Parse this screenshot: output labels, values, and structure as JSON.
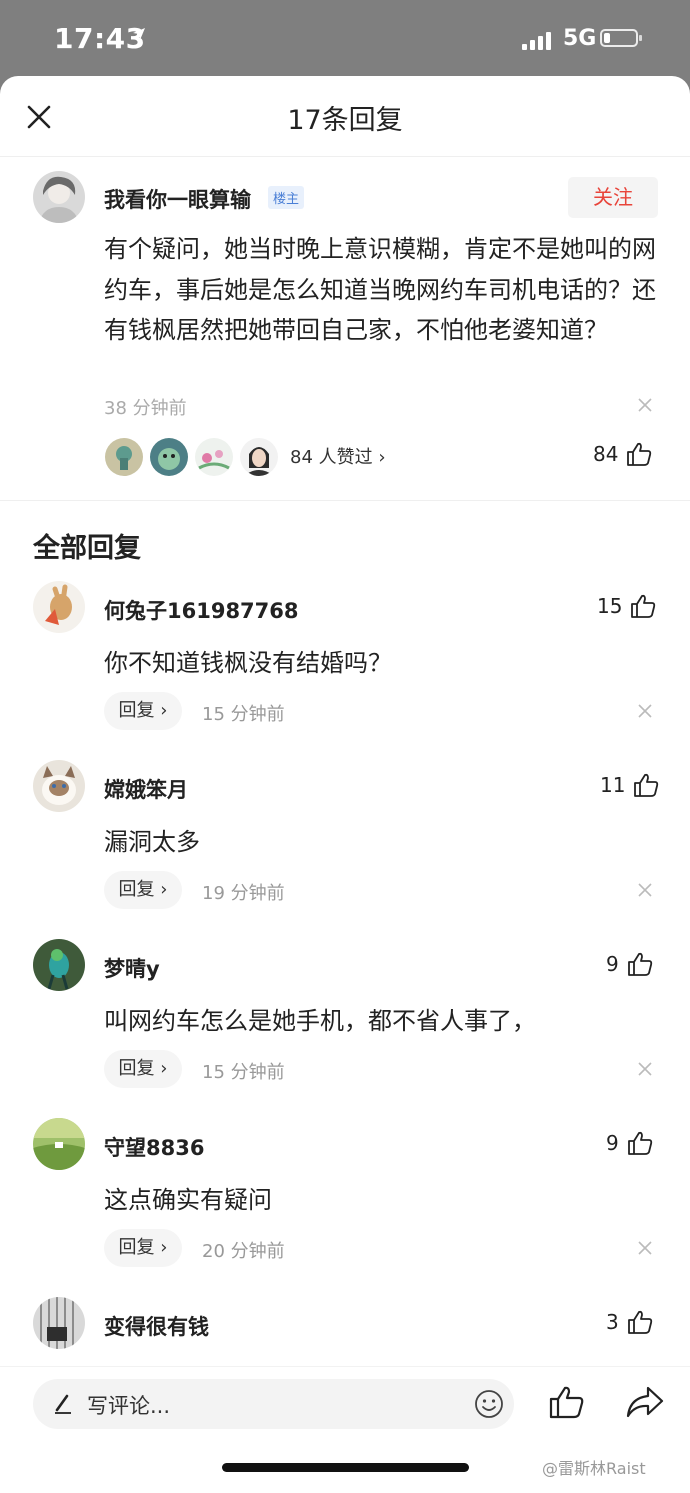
{
  "status_bar": {
    "time": "17:43",
    "network": "5G",
    "battery_level": 0.2
  },
  "header": {
    "title": "17条回复"
  },
  "main_post": {
    "username": "我看你一眼算输",
    "badge": "楼主",
    "follow_label": "关注",
    "text": "有个疑问，她当时晚上意识模糊，肯定不是她叫的网约车，事后她是怎么知道当晚网约车司机电话的？还有钱枫居然把她带回自己家，不怕他老婆知道？",
    "time": "38 分钟前",
    "liked_by": "84 人赞过",
    "like_count": "84"
  },
  "section_title": "全部回复",
  "replies": [
    {
      "username": "何兔子161987768",
      "text": "你不知道钱枫没有结婚吗？",
      "reply_label": "回复",
      "time": "15 分钟前",
      "like_count": "15"
    },
    {
      "username": "嫦娥笨月",
      "text": "漏洞太多",
      "reply_label": "回复",
      "time": "19 分钟前",
      "like_count": "11"
    },
    {
      "username": "梦晴y",
      "text": "叫网约车怎么是她手机，都不省人事了，",
      "reply_label": "回复",
      "time": "15 分钟前",
      "like_count": "9"
    },
    {
      "username": "守望8836",
      "text": "这点确实有疑问",
      "reply_label": "回复",
      "time": "20 分钟前",
      "like_count": "9"
    },
    {
      "username": "变得很有钱",
      "like_count": "3"
    }
  ],
  "bottom_bar": {
    "placeholder": "写评论...",
    "watermark": "@雷斯林Raist"
  }
}
